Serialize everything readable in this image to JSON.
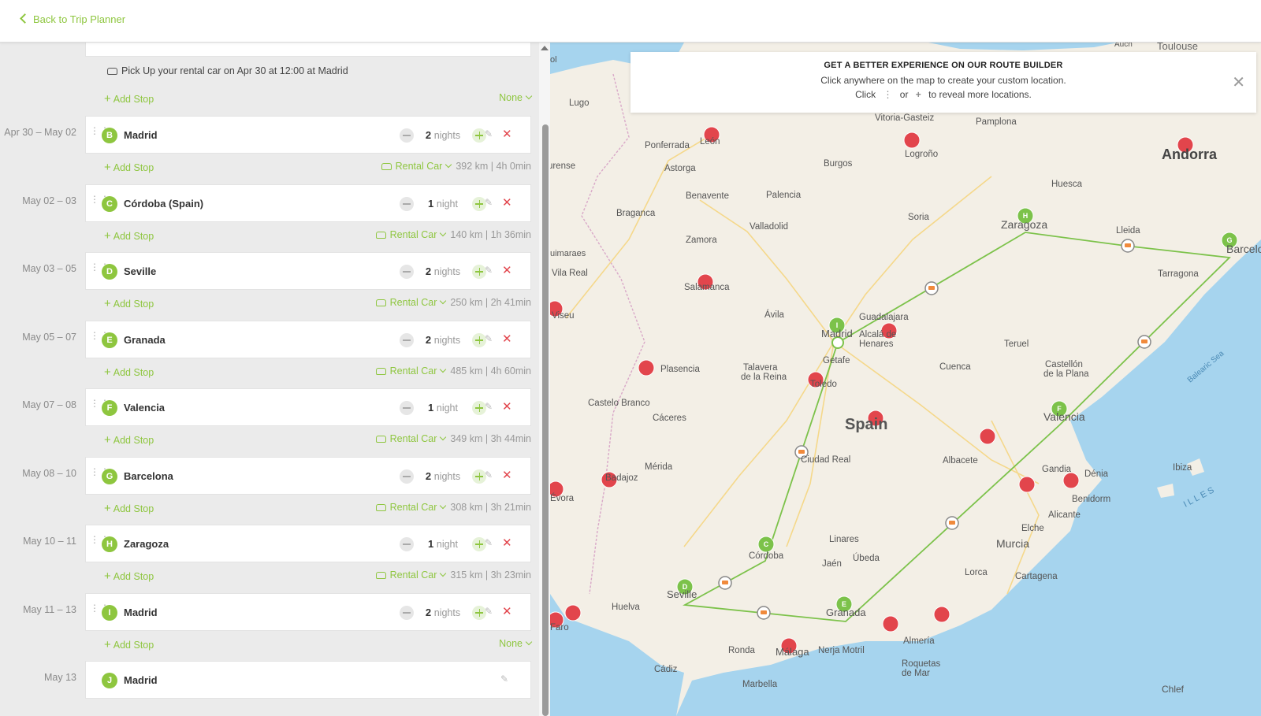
{
  "topbar": {
    "back_label": "Back to Trip Planner"
  },
  "pickup_text": "Pick Up your rental car on Apr 30 at 12:00 at Madrid",
  "first_transport": "None",
  "add_stop_label": "Add Stop",
  "stops": [
    {
      "letter": "B",
      "date": "Apr 30 – May 02",
      "city": "Madrid",
      "count": "2",
      "unit": "nights",
      "transport": "Rental Car",
      "distance": "392 km | 4h 0min"
    },
    {
      "letter": "C",
      "date": "May 02 – 03",
      "city": "Córdoba (Spain)",
      "count": "1",
      "unit": "night",
      "transport": "Rental Car",
      "distance": "140 km | 1h 36min"
    },
    {
      "letter": "D",
      "date": "May 03 – 05",
      "city": "Seville",
      "count": "2",
      "unit": "nights",
      "transport": "Rental Car",
      "distance": "250 km | 2h 41min"
    },
    {
      "letter": "E",
      "date": "May 05 – 07",
      "city": "Granada",
      "count": "2",
      "unit": "nights",
      "transport": "Rental Car",
      "distance": "485 km | 4h 60min"
    },
    {
      "letter": "F",
      "date": "May 07 – 08",
      "city": "Valencia",
      "count": "1",
      "unit": "night",
      "transport": "Rental Car",
      "distance": "349 km | 3h 44min"
    },
    {
      "letter": "G",
      "date": "May 08 – 10",
      "city": "Barcelona",
      "count": "2",
      "unit": "nights",
      "transport": "Rental Car",
      "distance": "308 km | 3h 21min"
    },
    {
      "letter": "H",
      "date": "May 10 – 11",
      "city": "Zaragoza",
      "count": "1",
      "unit": "night",
      "transport": "Rental Car",
      "distance": "315 km | 3h 23min"
    },
    {
      "letter": "I",
      "date": "May 11 – 13",
      "city": "Madrid",
      "count": "2",
      "unit": "nights",
      "transport": "None",
      "distance": ""
    }
  ],
  "final_stop": {
    "letter": "J",
    "date": "May 13",
    "city": "Madrid"
  },
  "banner": {
    "title": "GET A BETTER EXPERIENCE ON OUR ROUTE BUILDER",
    "line1": "Click anywhere on the map to create your custom location.",
    "line2_a": "Click",
    "line2_b": "or",
    "line2_c": "to reveal more locations."
  },
  "map": {
    "place_names": [
      "Auch",
      "Toulouse",
      "Lugo",
      "Vitoria-Gasteiz",
      "Pamplona",
      "Ponferrada",
      "León",
      "Logroño",
      "Andorra",
      "Ourense",
      "Astorga",
      "Burgos",
      "Huesca",
      "Benavente",
      "Palencia",
      "Braganca",
      "Soria",
      "Zaragoza",
      "Lleida",
      "Zamora",
      "Valladolid",
      "Barcelona",
      "Tarragona",
      "Vila Real",
      "Salamanca",
      "Ávila",
      "Guadalajara",
      "Madrid",
      "Alcalá de Henares",
      "Getafe",
      "Teruel",
      "Viseu",
      "Plasencia",
      "Talavera de la Reina",
      "Toledo",
      "Cuenca",
      "Castellón de la Plana",
      "Castelo Branco",
      "Cáceres",
      "Spain",
      "Valencia",
      "Mérida",
      "Badajoz",
      "Ciudad Real",
      "Albacete",
      "Gandia",
      "Dénia",
      "Ibiza",
      "Évora",
      "Alicante",
      "Benidorm",
      "Elche",
      "Linares",
      "Córdoba",
      "Úbeda",
      "Murcia",
      "Jaén",
      "Cartagena",
      "Lorca",
      "Huelva",
      "Seville",
      "Granada",
      "Almería",
      "Faro",
      "Ronda",
      "Málaga",
      "Nerja Motril",
      "Roquetas de Mar",
      "Cádiz",
      "Marbella",
      "Chlef",
      "Balearic Sea",
      "ILLES",
      "uimaraes",
      "ol"
    ],
    "route_color": "#7cc24a",
    "pin_red": "#e2454c",
    "pin_green": "#7cc24a",
    "water": "#a6d4ee"
  }
}
